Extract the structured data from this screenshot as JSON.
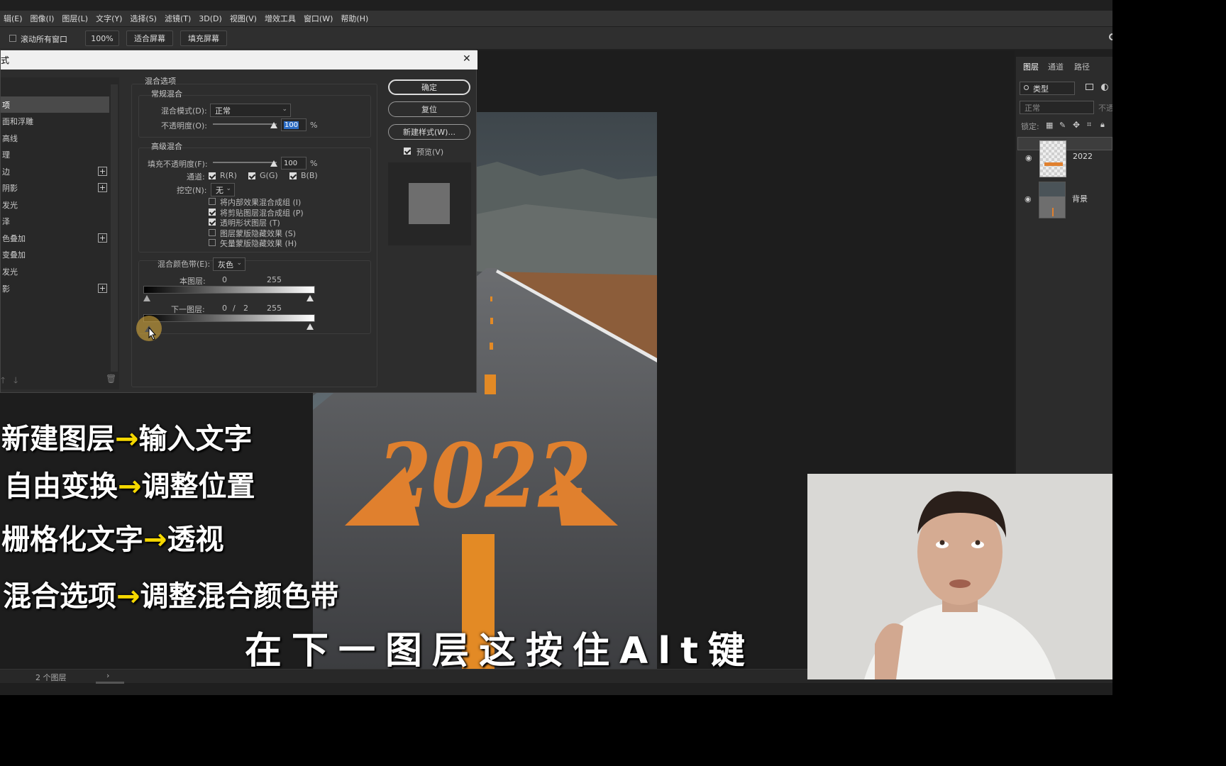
{
  "menu": [
    "辑(E)",
    "图像(I)",
    "图层(L)",
    "文字(Y)",
    "选择(S)",
    "滤镜(T)",
    "3D(D)",
    "视图(V)",
    "增效工具",
    "窗口(W)",
    "帮助(H)"
  ],
  "options": {
    "scroll_all": "滚动所有窗口",
    "zoom": "100%",
    "fit_screen": "适合屏幕",
    "fill_screen": "填充屏幕"
  },
  "dialog": {
    "title": "式",
    "close": "✕",
    "styles": [
      {
        "label": "项",
        "active": true,
        "plus": false
      },
      {
        "label": "面和浮雕",
        "plus": false
      },
      {
        "label": "高线",
        "plus": false
      },
      {
        "label": "理",
        "plus": false
      },
      {
        "label": "边",
        "plus": true
      },
      {
        "label": "阴影",
        "plus": true
      },
      {
        "label": "发光",
        "plus": false
      },
      {
        "label": "泽",
        "plus": false
      },
      {
        "label": "色叠加",
        "plus": true
      },
      {
        "label": "变叠加",
        "plus": false
      },
      {
        "label": "发光",
        "plus": false
      },
      {
        "label": "影",
        "plus": true
      }
    ],
    "blend_options_title": "混合选项",
    "general_blending": "常规混合",
    "blend_mode_label": "混合模式(D):",
    "blend_mode_value": "正常",
    "opacity_label": "不透明度(O):",
    "opacity_value": "100",
    "percent": "%",
    "advanced_blending": "高级混合",
    "fill_opacity_label": "填充不透明度(F):",
    "fill_opacity_value": "100",
    "channels_label": "通道:",
    "channel_r": "R(R)",
    "channel_g": "G(G)",
    "channel_b": "B(B)",
    "knockout_label": "挖空(N):",
    "knockout_value": "无",
    "options": [
      {
        "label": "将内部效果混合成组 (I)",
        "checked": false
      },
      {
        "label": "将剪贴图层混合成组 (P)",
        "checked": true
      },
      {
        "label": "透明形状图层 (T)",
        "checked": true
      },
      {
        "label": "图层蒙版隐藏效果 (S)",
        "checked": false
      },
      {
        "label": "矢量蒙版隐藏效果 (H)",
        "checked": false
      }
    ],
    "blend_if_label": "混合颜色带(E):",
    "blend_if_value": "灰色",
    "this_layer_label": "本图层:",
    "this_layer_low": "0",
    "this_layer_high": "255",
    "underlying_label": "下一图层:",
    "underlying_low": "0",
    "underlying_sep": "/",
    "underlying_mid": "2",
    "underlying_high": "255",
    "ok": "确定",
    "reset": "复位",
    "new_style": "新建样式(W)...",
    "preview": "预览(V)"
  },
  "panels": {
    "tabs": [
      "图层",
      "通道",
      "路径"
    ],
    "filter": "类型",
    "mode": "正常",
    "opacity_short": "不透",
    "lock_label": "锁定:",
    "layers": [
      {
        "name": "2022",
        "selected": true
      },
      {
        "name": "背景",
        "selected": false
      }
    ]
  },
  "status": {
    "layers_count": "2 个图层",
    "chevron": "›"
  },
  "artwork_text": "2022",
  "overlays": {
    "line1a": "新建图层",
    "line1b": "输入文字",
    "line2a": "自由变换",
    "line2b": "调整位置",
    "line3a": "栅格化文字",
    "line3b": "透视",
    "line4a": "混合选项",
    "line4b": "调整混合颜色带",
    "arrow": "→",
    "subtitle": "在下一图层这按住Alt键"
  },
  "colors": {
    "accent_orange": "#e0802e",
    "arrow_yellow": "#f5d800",
    "ui_bg": "#2d2d2d"
  }
}
